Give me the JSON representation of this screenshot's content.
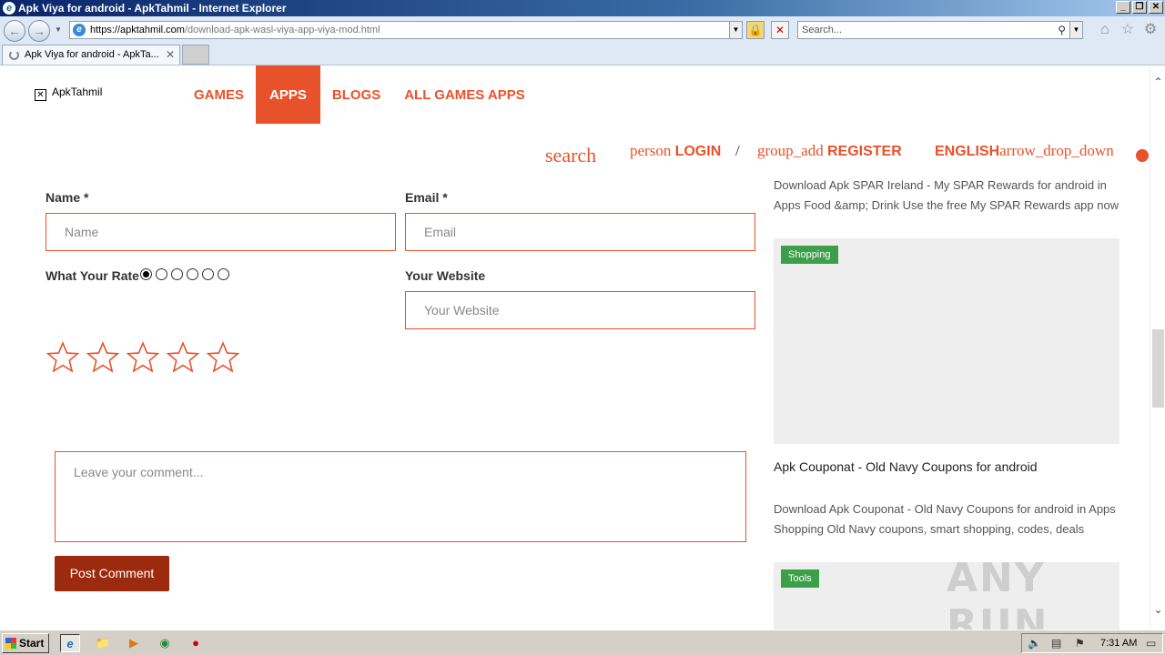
{
  "window": {
    "title": "Apk Viya for android - ApkTahmil - Internet Explorer",
    "minimize": "_",
    "restore": "❐",
    "close": "✕"
  },
  "address_bar": {
    "url_host": "https://apktahmil.com",
    "url_path": "/download-apk-wasl-viya-app-viya-mod.html",
    "search_placeholder": "Search..."
  },
  "tabs": [
    {
      "label": "Apk Viya for android - ApkTa...",
      "close": "✕"
    }
  ],
  "site": {
    "brand": "ApkTahmil",
    "nav": [
      {
        "label": "GAMES"
      },
      {
        "label": "APPS",
        "active": true
      },
      {
        "label": "BLOGS"
      },
      {
        "label": "ALL GAMES APPS"
      }
    ],
    "subnav": {
      "search": "search",
      "login_icon": "person",
      "login": "LOGIN",
      "separator": "/",
      "register_icon": "group_add",
      "register": "REGISTER",
      "language": "ENGLISH",
      "language_icon": "arrow_drop_down"
    }
  },
  "form": {
    "name_label": "Name *",
    "name_placeholder": "Name",
    "email_label": "Email *",
    "email_placeholder": "Email",
    "rate_label": "What Your Rate",
    "rate_options": 6,
    "rate_selected_index": 0,
    "website_label": "Your Website",
    "website_placeholder": "Your Website",
    "star_count": 5,
    "stars_filled": 0,
    "comment_placeholder": "Leave your comment...",
    "submit_label": "Post Comment"
  },
  "sidebar": {
    "item1_description": "Download Apk SPAR Ireland - My SPAR Rewards for android in Apps Food &amp; Drink Use the free My SPAR Rewards app now",
    "card1_category": "Shopping",
    "item2_title": "Apk Couponat - Old Navy Coupons for android",
    "item2_description": "Download Apk Couponat - Old Navy Coupons for android in Apps Shopping Old Navy coupons, smart shopping, codes, deals",
    "card2_category": "Tools"
  },
  "watermark": "ANY RUN",
  "taskbar": {
    "start_label": "Start",
    "clock": "7:31 AM"
  },
  "colors": {
    "accent": "#e8522a",
    "button_dark": "#9c2a0e",
    "badge_green": "#3ca04a"
  }
}
